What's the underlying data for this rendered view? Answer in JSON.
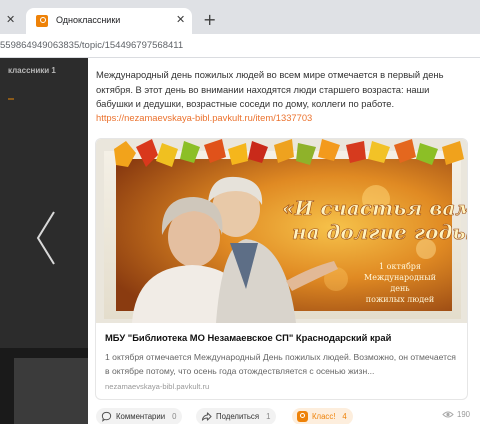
{
  "browser": {
    "tab_title": "Одноклассники",
    "url": "559864949063835/topic/154496797568411"
  },
  "background": {
    "nav_label": "классники  1"
  },
  "post": {
    "text": "Международный день пожилых людей во всем мире отмечается в первый день октября. В этот день во внимании находятся люди старшего возраста: наши бабушки и дедушки, возрастные соседи по дому, коллеги по работе.",
    "link": "https://nezamaevskaya-bibl.pavkult.ru/item/1337703",
    "card": {
      "image_line1": "«И счастья вам",
      "image_line2": "на долгие годы»",
      "image_caption_1": "1 октября",
      "image_caption_2": "Международный",
      "image_caption_3": "день",
      "image_caption_4": "пожилых людей",
      "title": "МБУ \"Библиотека МО Незамаевское СП\" Краснодарский край",
      "description": "1 октября отмечается Международный День пожилых людей. Возможно, он отмечается в октябре потому, что осень года отождествляется с осенью жизн...",
      "domain": "nezamaevskaya-bibl.pavkult.ru"
    },
    "actions": {
      "comments_label": "Комментарии",
      "comments_count": "0",
      "share_label": "Поделиться",
      "share_count": "1",
      "klass_label": "Класс!",
      "klass_count": "4",
      "views_count": "190"
    }
  },
  "colors": {
    "accent": "#ee8208",
    "link": "#eb722e"
  }
}
